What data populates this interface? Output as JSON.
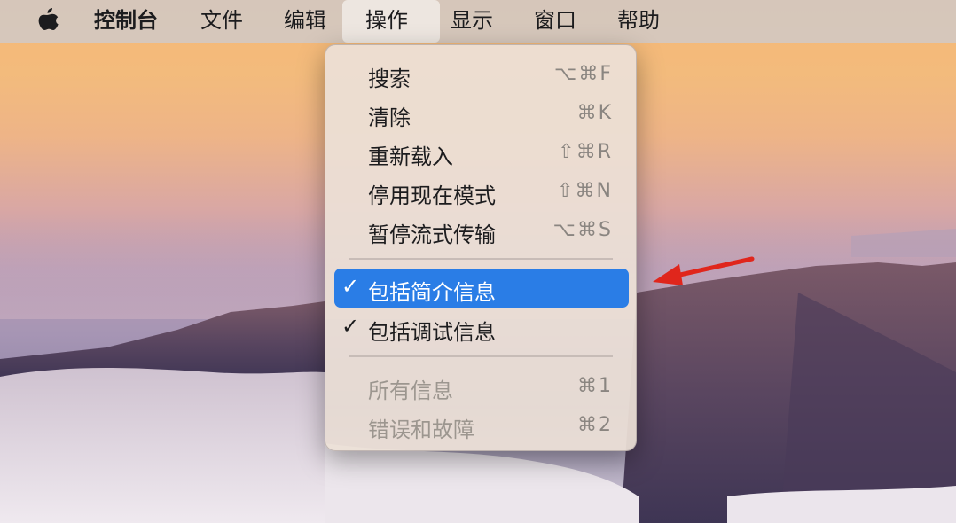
{
  "menubar": {
    "app_name": "控制台",
    "items": [
      "文件",
      "编辑",
      "操作",
      "显示",
      "窗口",
      "帮助"
    ]
  },
  "menu": {
    "items": [
      {
        "label": "搜索",
        "shortcut": "⌥⌘F"
      },
      {
        "label": "清除",
        "shortcut": "⌘K"
      },
      {
        "label": "重新载入",
        "shortcut": "⇧⌘R"
      },
      {
        "label": "停用现在模式",
        "shortcut": "⇧⌘N"
      },
      {
        "label": "暂停流式传输",
        "shortcut": "⌥⌘S"
      },
      {
        "label": "包括简介信息",
        "checked": true,
        "highlighted": true
      },
      {
        "label": "包括调试信息",
        "checked": true
      },
      {
        "label": "所有信息",
        "shortcut": "⌘1",
        "disabled": true
      },
      {
        "label": "错误和故障",
        "shortcut": "⌘2",
        "disabled": true
      }
    ],
    "check_glyph": "✓"
  },
  "colors": {
    "highlight": "#2a7de6",
    "annotation_arrow": "#e0261c"
  }
}
